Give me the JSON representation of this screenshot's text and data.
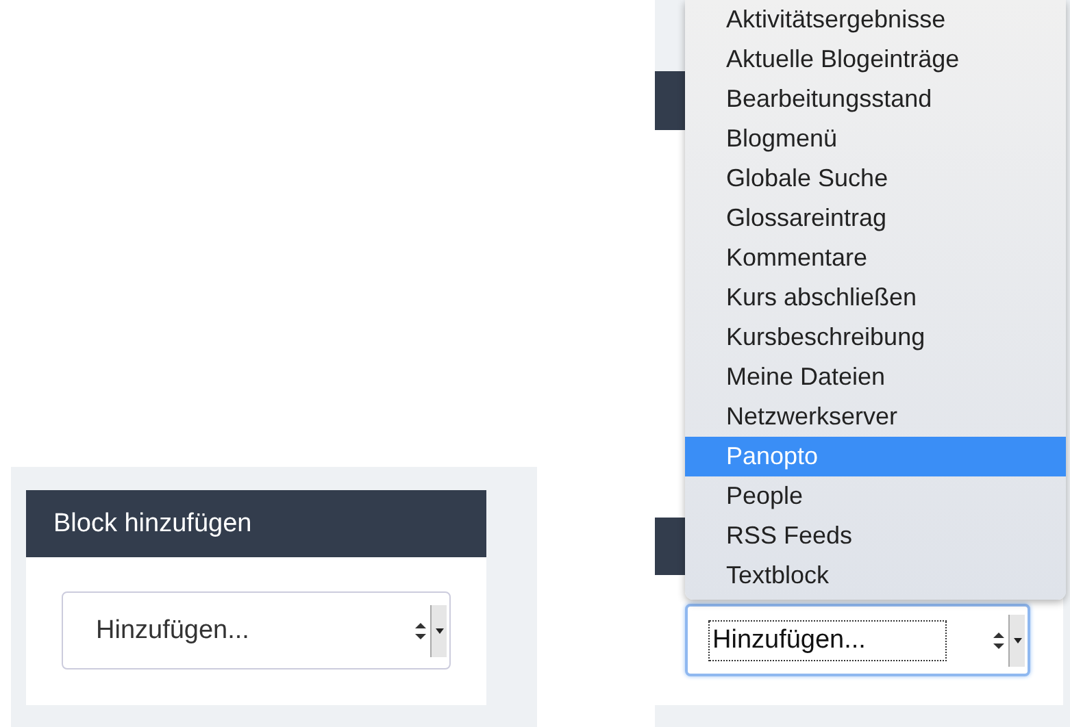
{
  "left_panel": {
    "title": "Block hinzufügen",
    "select": {
      "value": "Hinzufügen...",
      "focused": false
    }
  },
  "right_panel": {
    "select": {
      "value": "Hinzufügen...",
      "focused": true
    },
    "menu": {
      "items": [
        {
          "label": "Aktivitätsergebnisse",
          "selected": false
        },
        {
          "label": "Aktuelle Blogeinträge",
          "selected": false
        },
        {
          "label": "Bearbeitungsstand",
          "selected": false
        },
        {
          "label": "Blogmenü",
          "selected": false
        },
        {
          "label": "Globale Suche",
          "selected": false
        },
        {
          "label": "Glossareintrag",
          "selected": false
        },
        {
          "label": "Kommentare",
          "selected": false
        },
        {
          "label": "Kurs abschließen",
          "selected": false
        },
        {
          "label": "Kursbeschreibung",
          "selected": false
        },
        {
          "label": "Meine Dateien",
          "selected": false
        },
        {
          "label": "Netzwerkserver",
          "selected": false
        },
        {
          "label": "Panopto",
          "selected": true
        },
        {
          "label": "People",
          "selected": false
        },
        {
          "label": "RSS Feeds",
          "selected": false
        },
        {
          "label": "Textblock",
          "selected": false
        }
      ]
    }
  }
}
